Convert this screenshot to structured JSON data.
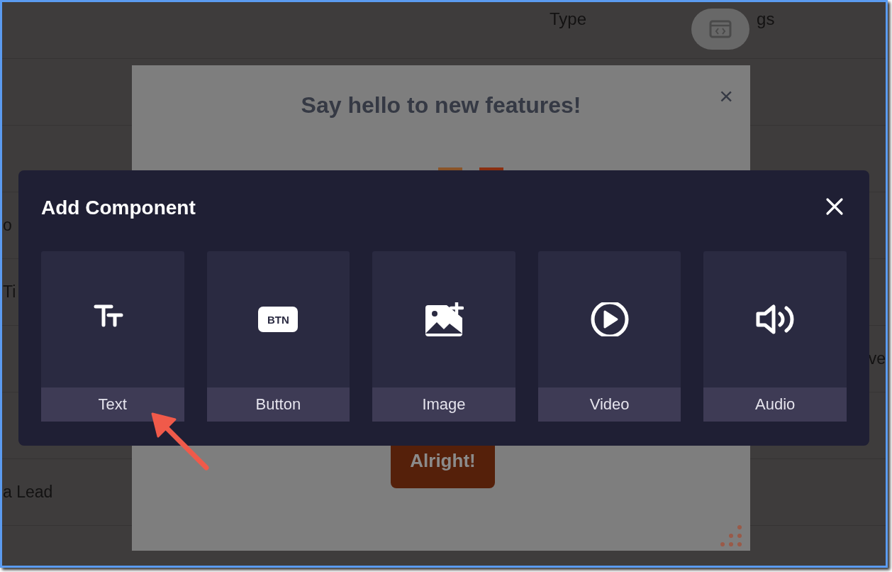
{
  "background_table": {
    "headers": [
      "Type",
      "gs"
    ],
    "rows": [
      {
        "column_1": "",
        "column_2": ""
      },
      {
        "column_1": "",
        "column_2": ""
      },
      {
        "column_1": "o",
        "column_2": ""
      },
      {
        "column_1": "Ti",
        "column_2": ""
      },
      {
        "column_1": "",
        "column_2": "ve"
      },
      {
        "column_1": "",
        "column_2": ""
      },
      {
        "column_1": "a Lead",
        "column_2": ""
      }
    ]
  },
  "feature_modal": {
    "title": "Say hello to new features!",
    "close": "×",
    "button": "Alright!"
  },
  "add_component_modal": {
    "title": "Add Component",
    "components": [
      {
        "kind": "text",
        "label": "Text"
      },
      {
        "kind": "button",
        "label": "Button",
        "icon_text": "BTN"
      },
      {
        "kind": "image",
        "label": "Image"
      },
      {
        "kind": "video",
        "label": "Video"
      },
      {
        "kind": "audio",
        "label": "Audio"
      }
    ]
  }
}
